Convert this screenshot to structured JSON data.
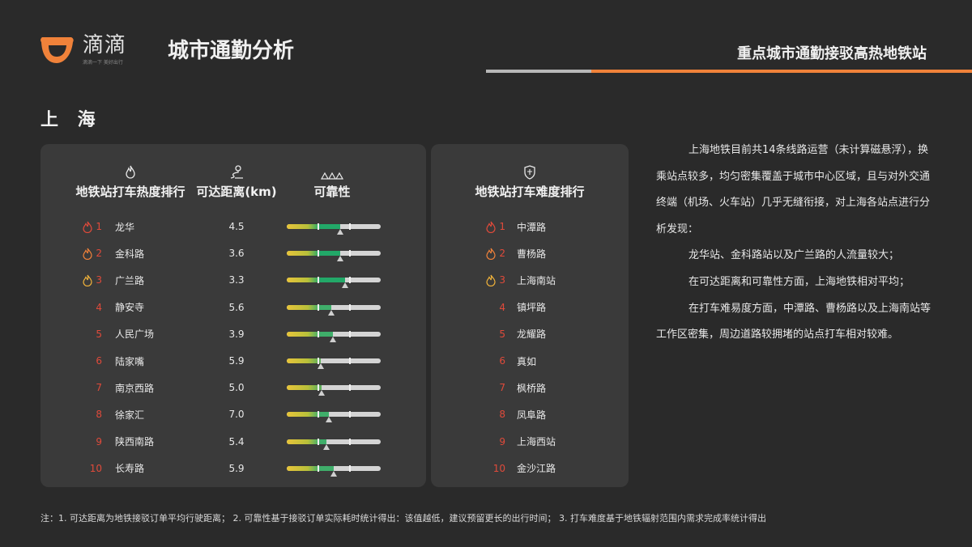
{
  "brand": {
    "logo_text": "滴滴",
    "logo_sub": "滴滴一下 美好出行",
    "accent_color": "#f0823a"
  },
  "header": {
    "title": "城市通勤分析",
    "subtitle": "重点城市通勤接驳高热地铁站"
  },
  "city": "上 海",
  "left_panel": {
    "col_heat": {
      "label": "地铁站打车热度排行",
      "icon": "flame-icon"
    },
    "col_distance": {
      "label": "可达距离(km)",
      "icon": "road-icon"
    },
    "col_reliability": {
      "label": "可靠性",
      "icon": "mountain-icon"
    },
    "rows": [
      {
        "rank": "1",
        "name": "龙华",
        "distance": "4.5",
        "reliability": 0.57,
        "fill_color": "#22a868"
      },
      {
        "rank": "2",
        "name": "金科路",
        "distance": "3.6",
        "reliability": 0.57,
        "fill_color": "#22a868"
      },
      {
        "rank": "3",
        "name": "广兰路",
        "distance": "3.3",
        "reliability": 0.62,
        "fill_color": "#22a868"
      },
      {
        "rank": "4",
        "name": "静安寺",
        "distance": "5.6",
        "reliability": 0.47,
        "fill_color": "#3fae6a"
      },
      {
        "rank": "5",
        "name": "人民广场",
        "distance": "3.9",
        "reliability": 0.49,
        "fill_color": "#3fae6a"
      },
      {
        "rank": "6",
        "name": "陆家嘴",
        "distance": "5.9",
        "reliability": 0.36,
        "fill_color": "#5fae5a"
      },
      {
        "rank": "7",
        "name": "南京西路",
        "distance": "5.0",
        "reliability": 0.37,
        "fill_color": "#5fae5a"
      },
      {
        "rank": "8",
        "name": "徐家汇",
        "distance": "7.0",
        "reliability": 0.45,
        "fill_color": "#3fae6a"
      },
      {
        "rank": "9",
        "name": "陕西南路",
        "distance": "5.4",
        "reliability": 0.42,
        "fill_color": "#3fae6a"
      },
      {
        "rank": "10",
        "name": "长寿路",
        "distance": "5.9",
        "reliability": 0.5,
        "fill_color": "#3fae6a"
      }
    ]
  },
  "right_panel": {
    "label": "地铁站打车难度排行",
    "icon": "badge-icon",
    "rows": [
      {
        "rank": "1",
        "name": "中潭路"
      },
      {
        "rank": "2",
        "name": "曹杨路"
      },
      {
        "rank": "3",
        "name": "上海南站"
      },
      {
        "rank": "4",
        "name": "镇坪路"
      },
      {
        "rank": "5",
        "name": "龙耀路"
      },
      {
        "rank": "6",
        "name": "真如"
      },
      {
        "rank": "7",
        "name": "枫桥路"
      },
      {
        "rank": "8",
        "name": "凤阜路"
      },
      {
        "rank": "9",
        "name": "上海西站"
      },
      {
        "rank": "10",
        "name": "金沙江路"
      }
    ]
  },
  "description": {
    "p1": "上海地铁目前共14条线路运营（未计算磁悬浮），换乘站点较多，均匀密集覆盖于城市中心区域，且与对外交通终端（机场、火车站）几乎无缝衔接，对上海各站点进行分析发现：",
    "p2": "龙华站、金科路站以及广兰路的人流量较大；",
    "p3": "在可达距离和可靠性方面，上海地铁相对平均；",
    "p4": "在打车难易度方面，中潭路、曹杨路以及上海南站等工作区密集，周边道路较拥堵的站点打车相对较难。"
  },
  "footnote": "注：1. 可达距离为地铁接驳订单平均行驶距离；    2. 可靠性基于接驳订单实际耗时统计得出：该值越低，建议预留更长的出行时间；    3. 打车难度基于地铁辐射范围内需求完成率统计得出",
  "colors": {
    "bg": "#2a2a2a",
    "panel": "#3a3a3a",
    "rank_red": "#e04a3a",
    "flame_1": "#e04a3a",
    "flame_2": "#f0823a",
    "flame_3": "#f0b23a"
  }
}
